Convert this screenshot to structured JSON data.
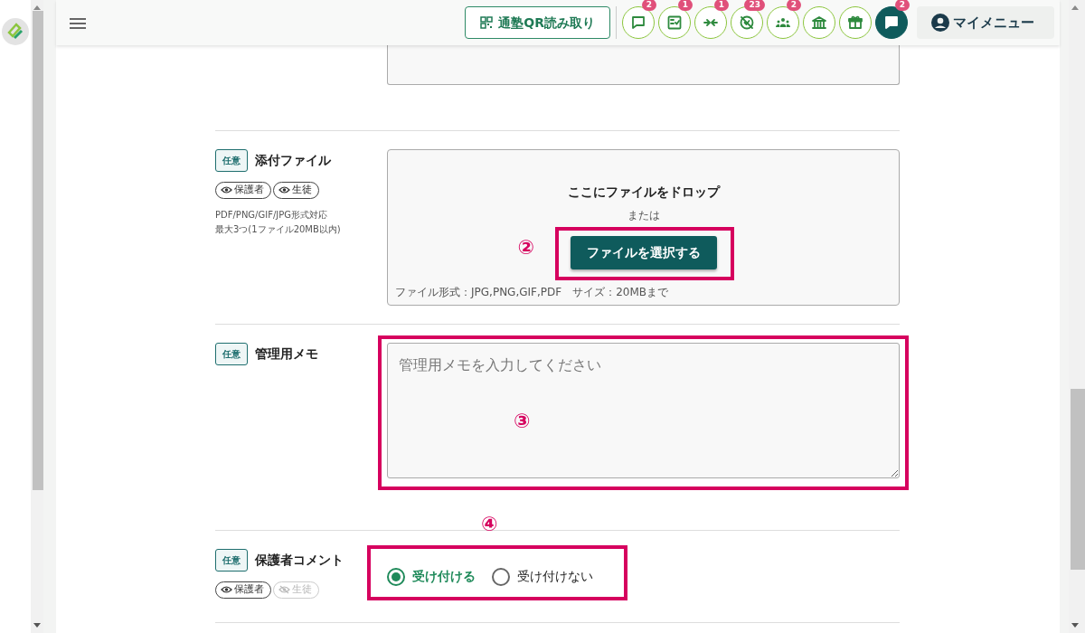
{
  "header": {
    "qr_button": "通塾QR読み取り",
    "icon_buttons": [
      {
        "kind": "chat",
        "badge": "2"
      },
      {
        "kind": "checklist",
        "badge": "1"
      },
      {
        "kind": "arrows",
        "badge": "1"
      },
      {
        "kind": "nosign",
        "badge": "23"
      },
      {
        "kind": "group",
        "badge": "2"
      },
      {
        "kind": "bank"
      },
      {
        "kind": "gift"
      },
      {
        "kind": "chat-solid",
        "badge": "2"
      }
    ],
    "my_menu": "マイメニュー"
  },
  "rows": [
    {
      "kind": "partial-textarea"
    },
    {
      "kind": "file",
      "tag": "任意",
      "label": "添付ファイル",
      "chips": [
        {
          "text": "保護者",
          "visible": true
        },
        {
          "text": "生徒",
          "visible": true
        }
      ],
      "notes": [
        "PDF/PNG/GIF/JPG形式対応",
        "最大3つ(1ファイル20MB以内)"
      ],
      "drop_title": "ここにファイルをドロップ",
      "drop_or": "または",
      "button": "ファイルを選択する",
      "annotation": "②",
      "drop_hint": "ファイル形式：JPG,PNG,GIF,PDF　サイズ：20MBまで"
    },
    {
      "kind": "memo",
      "tag": "任意",
      "label": "管理用メモ",
      "placeholder": "管理用メモを入力してください",
      "annotation": "③"
    },
    {
      "kind": "radio",
      "tag": "任意",
      "label": "保護者コメント",
      "chips": [
        {
          "text": "保護者",
          "visible": true
        },
        {
          "text": "生徒",
          "visible": false
        }
      ],
      "annotation": "④",
      "options": [
        {
          "label": "受け付ける",
          "selected": true
        },
        {
          "label": "受け付けない",
          "selected": false
        }
      ]
    }
  ]
}
